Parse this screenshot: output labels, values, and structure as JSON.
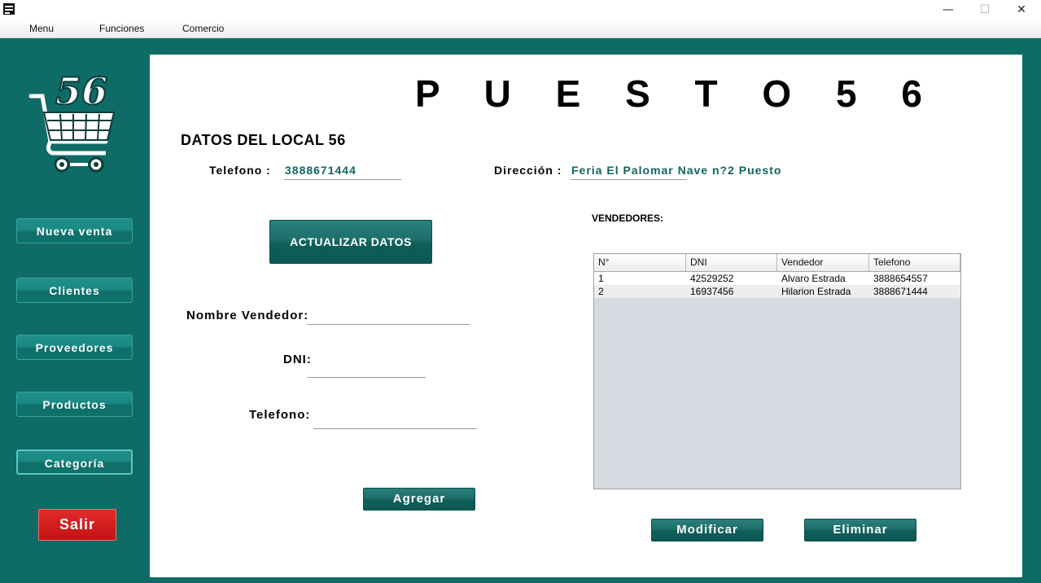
{
  "titlebar": {
    "minimize": "—",
    "maximize": "☐",
    "close": "✕"
  },
  "menubar": {
    "items": [
      "Menu",
      "Funciones",
      "Comercio"
    ]
  },
  "sidebar": {
    "logo_text": "56",
    "buttons": [
      "Nueva venta",
      "Clientes",
      "Proveedores",
      "Productos",
      "Categoría"
    ],
    "exit_label": "Salir"
  },
  "main": {
    "title": "P U E S T O   5 6",
    "section_title": "DATOS DEL LOCAL 56",
    "telefono_label": "Telefono :",
    "telefono_value": "3888671444",
    "direccion_label": "Dirección :",
    "direccion_value": "Feria El Palomar Nave n?2 Puesto",
    "update_button": "ACTUALIZAR DATOS",
    "form": {
      "nombre_label": "Nombre Vendedor:",
      "dni_label": "DNI:",
      "telefono_label": "Telefono:",
      "nombre_value": "",
      "dni_value": "",
      "telefono_value": ""
    },
    "add_button": "Agregar",
    "vendedores_label": "VENDEDORES:",
    "table": {
      "headers": [
        "N°",
        "DNI",
        "Vendedor",
        "Telefono"
      ],
      "rows": [
        [
          "1",
          "42529252",
          "Alvaro Estrada",
          "3888654557"
        ],
        [
          "2",
          "16937456",
          "Hilarion Estrada",
          "3888671444"
        ]
      ]
    },
    "modify_button": "Modificar",
    "delete_button": "Eliminar"
  },
  "colors": {
    "frame": "#0f6b66",
    "accent_text": "#12655f",
    "exit": "#d01d1d",
    "table_bg": "#d7dae1"
  }
}
